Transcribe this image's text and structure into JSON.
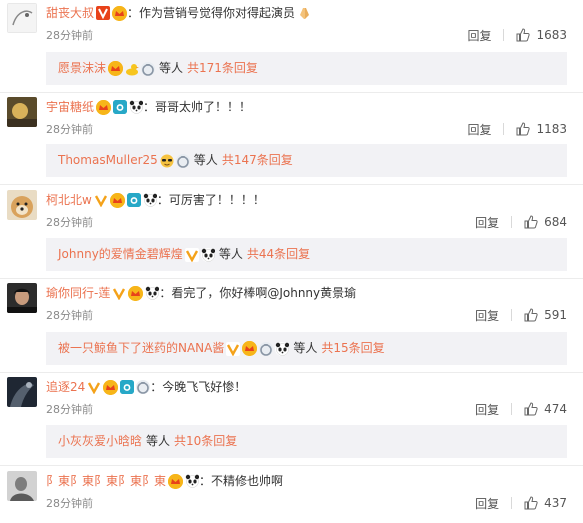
{
  "comments": [
    {
      "username": "甜丧大叔",
      "text": "：作为营销号觉得你对得起演员",
      "time": "28分钟前",
      "reply_label": "回复",
      "likes": "1683",
      "sub": {
        "name": "愿景沫沫",
        "mid": "等人",
        "count": "共171条回复"
      }
    },
    {
      "username": "宇宙糖纸",
      "text": "：哥哥太帅了！！！",
      "time": "28分钟前",
      "reply_label": "回复",
      "likes": "1183",
      "sub": {
        "name": "ThomasMuller25",
        "mid": "等人",
        "count": "共147条回复"
      }
    },
    {
      "username": "柯北北w",
      "text": "：可厉害了！！！！",
      "time": "28分钟前",
      "reply_label": "回复",
      "likes": "684",
      "sub": {
        "name": "Johnny的爱情金碧辉煌",
        "mid": "等人",
        "count": "共44条回复"
      }
    },
    {
      "username": "瑜你同行-莲",
      "text": "：看完了，你好棒啊@Johnny黄景瑜",
      "time": "28分钟前",
      "reply_label": "回复",
      "likes": "591",
      "sub": {
        "name": "被一只鲸鱼下了迷药的NANA酱",
        "mid": "等人",
        "count": "共15条回复"
      }
    },
    {
      "username": "追逐24",
      "text": "：今晚飞飞好惨！",
      "time": "28分钟前",
      "reply_label": "回复",
      "likes": "474",
      "sub": {
        "name": "小灰灰爱小晗晗",
        "mid": "等人",
        "count": "共10条回复"
      }
    },
    {
      "username": "阝東阝東阝東阝東阝東",
      "text": "：不精修也帅啊",
      "time": "28分钟前",
      "reply_label": "回复",
      "likes": "437"
    }
  ],
  "colors": {
    "username": "#eb7350",
    "text": "#333333",
    "meta": "#8a8a8a",
    "sub_bg": "#f2f2f5"
  },
  "icons": [
    "verified-v-icon",
    "vip-crown-icon",
    "camera-badge-icon",
    "ring-badge-icon",
    "panda-emoji-icon",
    "duck-emoji-icon",
    "praying-hands-emoji-icon",
    "thumbs-up-icon"
  ]
}
